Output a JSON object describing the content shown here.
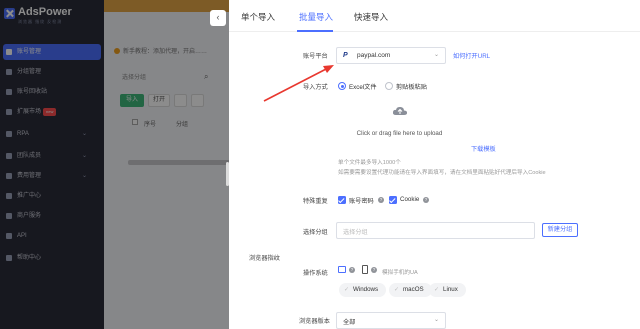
{
  "app": {
    "logo_text": "AdsPower",
    "logo_sub": "浏览器 指纹 反检测",
    "sidebar": [
      {
        "label": "账号管理",
        "active": true
      },
      {
        "label": "分组管理"
      },
      {
        "label": "账号回收站"
      },
      {
        "label": "扩展市场",
        "badge": "new"
      },
      {
        "label": "RPA",
        "chevron": "⌄"
      },
      {
        "label": "团队成员",
        "chevron": "⌄"
      },
      {
        "label": "费用管理",
        "chevron": "⌄"
      },
      {
        "label": "推广中心"
      },
      {
        "label": "商户服务"
      },
      {
        "label": "API"
      },
      {
        "label": "帮助中心"
      }
    ],
    "tip": "新手教程：添加代理，开启……",
    "group_placeholder": "选择分组",
    "import_btn": "导入",
    "toolbar_btn": "打开",
    "table_headers": [
      "序号",
      "分组"
    ]
  },
  "drawer": {
    "tabs": [
      "单个导入",
      "批量导入",
      "快速导入"
    ],
    "active_tab": 1,
    "platform": {
      "label": "账号平台",
      "value": "paypal.com",
      "link": "如何打开URL"
    },
    "import_method": {
      "label": "导入方式",
      "options": [
        "Excel文件",
        "剪贴板粘贴"
      ],
      "selected": 0
    },
    "upload": {
      "text": "Click or drag file here to upload",
      "template_link": "下载模板"
    },
    "hints": [
      "单个文件最多导入1000个",
      "如需要需要设置代理功能请在导入界面填写，请在文档里面粘贴好代理后导入Cookie"
    ],
    "skip_duplicates": {
      "label": "特殊重复",
      "options": [
        {
          "label": "账号密码",
          "checked": true
        },
        {
          "label": "Cookie",
          "checked": true
        }
      ]
    },
    "group": {
      "label": "选择分组",
      "placeholder": "选择分组",
      "button": "新建分组"
    },
    "browser_section_label": "浏览器指纹",
    "os": {
      "label": "操作系统",
      "ua_hint": "模拟手机的UA",
      "options": [
        "Windows",
        "macOS",
        "Linux"
      ]
    },
    "browser_version": {
      "label": "浏览器版本",
      "value": "全部"
    }
  },
  "colors": {
    "accent": "#4c6fff",
    "sidebar_bg": "#2b2d3a",
    "arrow": "#e8382f"
  }
}
